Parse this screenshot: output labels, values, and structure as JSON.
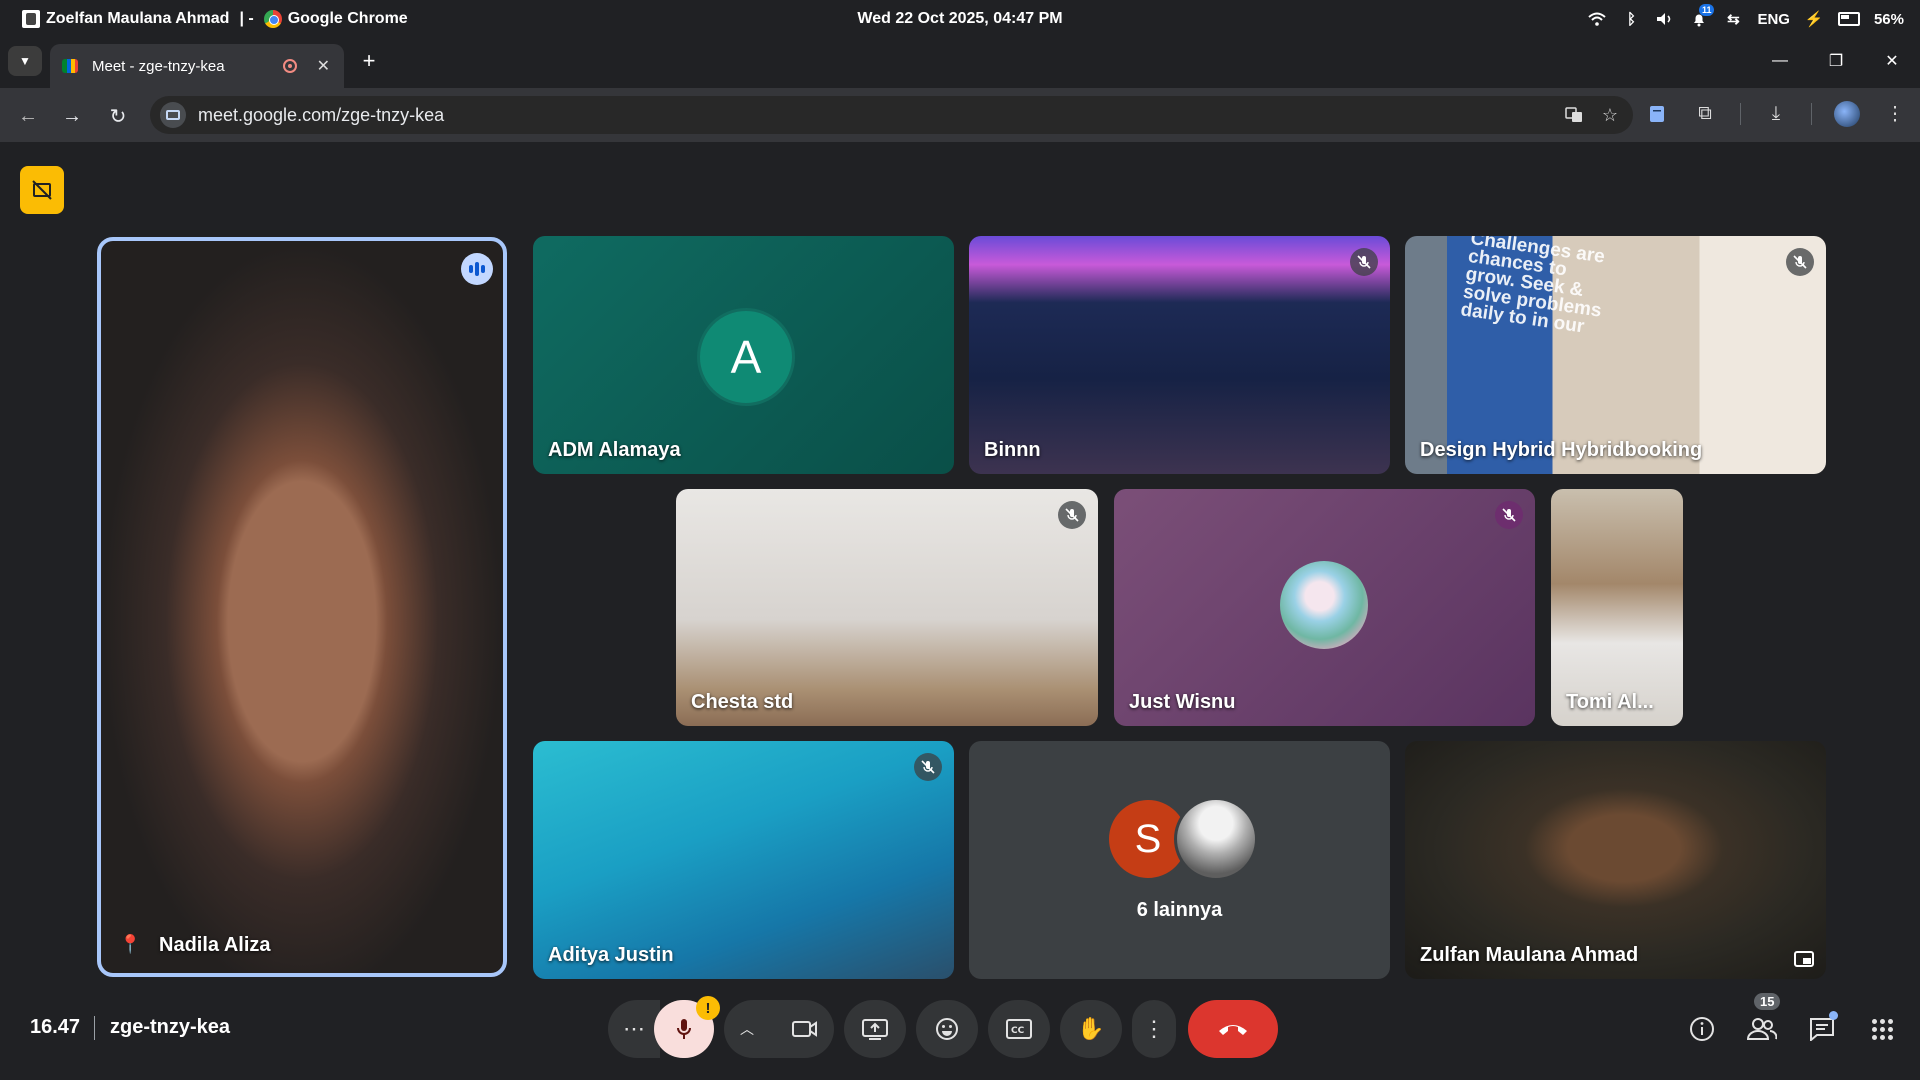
{
  "os": {
    "window_title_user": "Zoelfan Maulana Ahmad",
    "window_title_sep": "|  -",
    "window_title_app": "Google Chrome",
    "datetime": "Wed 22 Oct 2025, 04:47 PM",
    "notification_count": "11",
    "language": "ENG",
    "battery": "56%"
  },
  "browser": {
    "tab_title": "Meet - zge-tnzy-kea",
    "url": "meet.google.com/zge-tnzy-kea"
  },
  "participants": [
    {
      "name": "Nadila Aliza"
    },
    {
      "name": "ADM Alamaya",
      "initial": "A"
    },
    {
      "name": "Binnn"
    },
    {
      "name": "Design Hybrid Hybridbooking",
      "poster": "Challenges are chances to grow. Seek & solve problems daily to in our"
    },
    {
      "name": "Chesta std"
    },
    {
      "name": "Just Wisnu"
    },
    {
      "name": "Tomi Al..."
    },
    {
      "name": "Aditya Justin"
    },
    {
      "name": "Zulfan Maulana Ahmad"
    }
  ],
  "others_tile": {
    "initial": "S",
    "label": "6 lainnya"
  },
  "bottom": {
    "time": "16.47",
    "meeting_code": "zge-tnzy-kea",
    "people_count": "15",
    "mic_warning": "!"
  },
  "colors": {
    "accent_speaking": "#a8c7fa",
    "leave_button": "#dc362e",
    "recording_indicator": "#fbbc04",
    "muted_mic": "#f9dedc"
  },
  "icons": {
    "recording": "record-off-icon",
    "speaking": "speaking-indicator-icon",
    "muted": "mic-off-icon",
    "pin": "pin-icon"
  }
}
